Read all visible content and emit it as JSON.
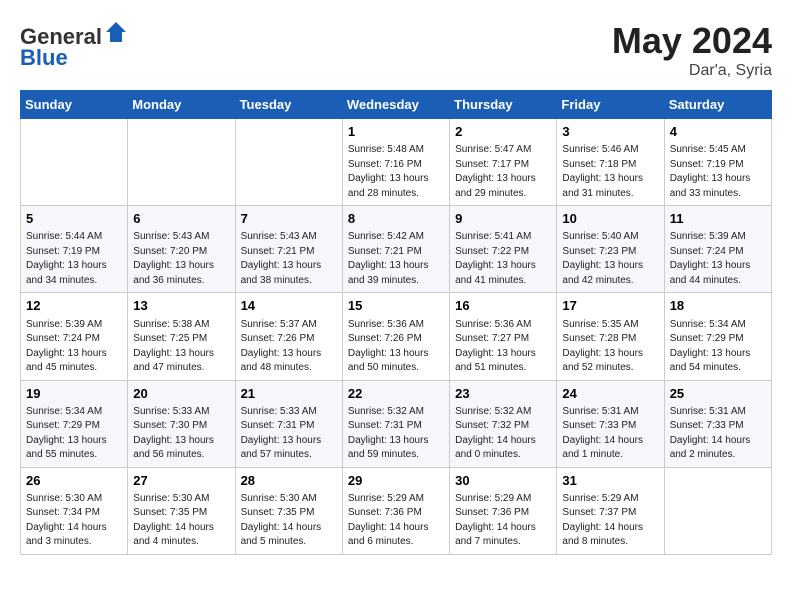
{
  "header": {
    "logo_line1": "General",
    "logo_line2": "Blue",
    "month_year": "May 2024",
    "location": "Dar'a, Syria"
  },
  "days_of_week": [
    "Sunday",
    "Monday",
    "Tuesday",
    "Wednesday",
    "Thursday",
    "Friday",
    "Saturday"
  ],
  "weeks": [
    [
      {
        "day": "",
        "info": ""
      },
      {
        "day": "",
        "info": ""
      },
      {
        "day": "",
        "info": ""
      },
      {
        "day": "1",
        "info": "Sunrise: 5:48 AM\nSunset: 7:16 PM\nDaylight: 13 hours\nand 28 minutes."
      },
      {
        "day": "2",
        "info": "Sunrise: 5:47 AM\nSunset: 7:17 PM\nDaylight: 13 hours\nand 29 minutes."
      },
      {
        "day": "3",
        "info": "Sunrise: 5:46 AM\nSunset: 7:18 PM\nDaylight: 13 hours\nand 31 minutes."
      },
      {
        "day": "4",
        "info": "Sunrise: 5:45 AM\nSunset: 7:19 PM\nDaylight: 13 hours\nand 33 minutes."
      }
    ],
    [
      {
        "day": "5",
        "info": "Sunrise: 5:44 AM\nSunset: 7:19 PM\nDaylight: 13 hours\nand 34 minutes."
      },
      {
        "day": "6",
        "info": "Sunrise: 5:43 AM\nSunset: 7:20 PM\nDaylight: 13 hours\nand 36 minutes."
      },
      {
        "day": "7",
        "info": "Sunrise: 5:43 AM\nSunset: 7:21 PM\nDaylight: 13 hours\nand 38 minutes."
      },
      {
        "day": "8",
        "info": "Sunrise: 5:42 AM\nSunset: 7:21 PM\nDaylight: 13 hours\nand 39 minutes."
      },
      {
        "day": "9",
        "info": "Sunrise: 5:41 AM\nSunset: 7:22 PM\nDaylight: 13 hours\nand 41 minutes."
      },
      {
        "day": "10",
        "info": "Sunrise: 5:40 AM\nSunset: 7:23 PM\nDaylight: 13 hours\nand 42 minutes."
      },
      {
        "day": "11",
        "info": "Sunrise: 5:39 AM\nSunset: 7:24 PM\nDaylight: 13 hours\nand 44 minutes."
      }
    ],
    [
      {
        "day": "12",
        "info": "Sunrise: 5:39 AM\nSunset: 7:24 PM\nDaylight: 13 hours\nand 45 minutes."
      },
      {
        "day": "13",
        "info": "Sunrise: 5:38 AM\nSunset: 7:25 PM\nDaylight: 13 hours\nand 47 minutes."
      },
      {
        "day": "14",
        "info": "Sunrise: 5:37 AM\nSunset: 7:26 PM\nDaylight: 13 hours\nand 48 minutes."
      },
      {
        "day": "15",
        "info": "Sunrise: 5:36 AM\nSunset: 7:26 PM\nDaylight: 13 hours\nand 50 minutes."
      },
      {
        "day": "16",
        "info": "Sunrise: 5:36 AM\nSunset: 7:27 PM\nDaylight: 13 hours\nand 51 minutes."
      },
      {
        "day": "17",
        "info": "Sunrise: 5:35 AM\nSunset: 7:28 PM\nDaylight: 13 hours\nand 52 minutes."
      },
      {
        "day": "18",
        "info": "Sunrise: 5:34 AM\nSunset: 7:29 PM\nDaylight: 13 hours\nand 54 minutes."
      }
    ],
    [
      {
        "day": "19",
        "info": "Sunrise: 5:34 AM\nSunset: 7:29 PM\nDaylight: 13 hours\nand 55 minutes."
      },
      {
        "day": "20",
        "info": "Sunrise: 5:33 AM\nSunset: 7:30 PM\nDaylight: 13 hours\nand 56 minutes."
      },
      {
        "day": "21",
        "info": "Sunrise: 5:33 AM\nSunset: 7:31 PM\nDaylight: 13 hours\nand 57 minutes."
      },
      {
        "day": "22",
        "info": "Sunrise: 5:32 AM\nSunset: 7:31 PM\nDaylight: 13 hours\nand 59 minutes."
      },
      {
        "day": "23",
        "info": "Sunrise: 5:32 AM\nSunset: 7:32 PM\nDaylight: 14 hours\nand 0 minutes."
      },
      {
        "day": "24",
        "info": "Sunrise: 5:31 AM\nSunset: 7:33 PM\nDaylight: 14 hours\nand 1 minute."
      },
      {
        "day": "25",
        "info": "Sunrise: 5:31 AM\nSunset: 7:33 PM\nDaylight: 14 hours\nand 2 minutes."
      }
    ],
    [
      {
        "day": "26",
        "info": "Sunrise: 5:30 AM\nSunset: 7:34 PM\nDaylight: 14 hours\nand 3 minutes."
      },
      {
        "day": "27",
        "info": "Sunrise: 5:30 AM\nSunset: 7:35 PM\nDaylight: 14 hours\nand 4 minutes."
      },
      {
        "day": "28",
        "info": "Sunrise: 5:30 AM\nSunset: 7:35 PM\nDaylight: 14 hours\nand 5 minutes."
      },
      {
        "day": "29",
        "info": "Sunrise: 5:29 AM\nSunset: 7:36 PM\nDaylight: 14 hours\nand 6 minutes."
      },
      {
        "day": "30",
        "info": "Sunrise: 5:29 AM\nSunset: 7:36 PM\nDaylight: 14 hours\nand 7 minutes."
      },
      {
        "day": "31",
        "info": "Sunrise: 5:29 AM\nSunset: 7:37 PM\nDaylight: 14 hours\nand 8 minutes."
      },
      {
        "day": "",
        "info": ""
      }
    ]
  ]
}
